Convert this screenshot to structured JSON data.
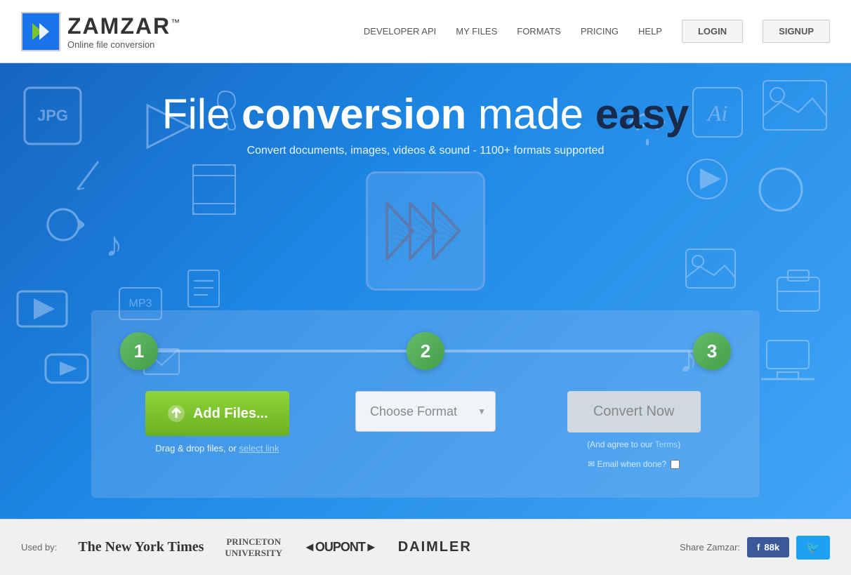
{
  "header": {
    "logo_name": "ZAMZAR",
    "logo_tm": "™",
    "logo_sub": "Online file conversion",
    "nav": {
      "links": [
        {
          "label": "DEVELOPER API",
          "id": "dev-api"
        },
        {
          "label": "MY FILES",
          "id": "my-files"
        },
        {
          "label": "FORMATS",
          "id": "formats"
        },
        {
          "label": "PRICING",
          "id": "pricing"
        },
        {
          "label": "HELP",
          "id": "help"
        }
      ],
      "login": "LOGIN",
      "signup": "SIGNUP"
    }
  },
  "hero": {
    "title_part1": "File ",
    "title_bold": "conversion",
    "title_part2": " made ",
    "title_dark": "easy",
    "subtitle": "Convert documents, images, videos & sound - 1100+ formats supported"
  },
  "steps": {
    "step1_num": "1",
    "step2_num": "2",
    "step3_num": "3",
    "add_files_label": "Add Files...",
    "drag_text": "Drag & drop files, or ",
    "select_link": "select link",
    "choose_format_placeholder": "Choose Format",
    "choose_format_arrow": "▼",
    "convert_now_label": "Convert Now",
    "agree_text": "(And agree to our ",
    "terms_link": "Terms",
    "agree_end": ")",
    "email_label": "✉ Email when done?",
    "email_checkbox": ""
  },
  "footer": {
    "used_by_label": "Used by:",
    "brands": [
      {
        "label": "The New York Times",
        "style": "times"
      },
      {
        "label": "PRINCETON\nUNIVERSITY",
        "style": "princeton"
      },
      {
        "label": "◄OUPONT►",
        "style": "dupont"
      },
      {
        "label": "DAIMLER",
        "style": "daimler"
      }
    ],
    "share_label": "Share Zamzar:",
    "fb_label": "f  88k",
    "tw_label": "🐦"
  }
}
